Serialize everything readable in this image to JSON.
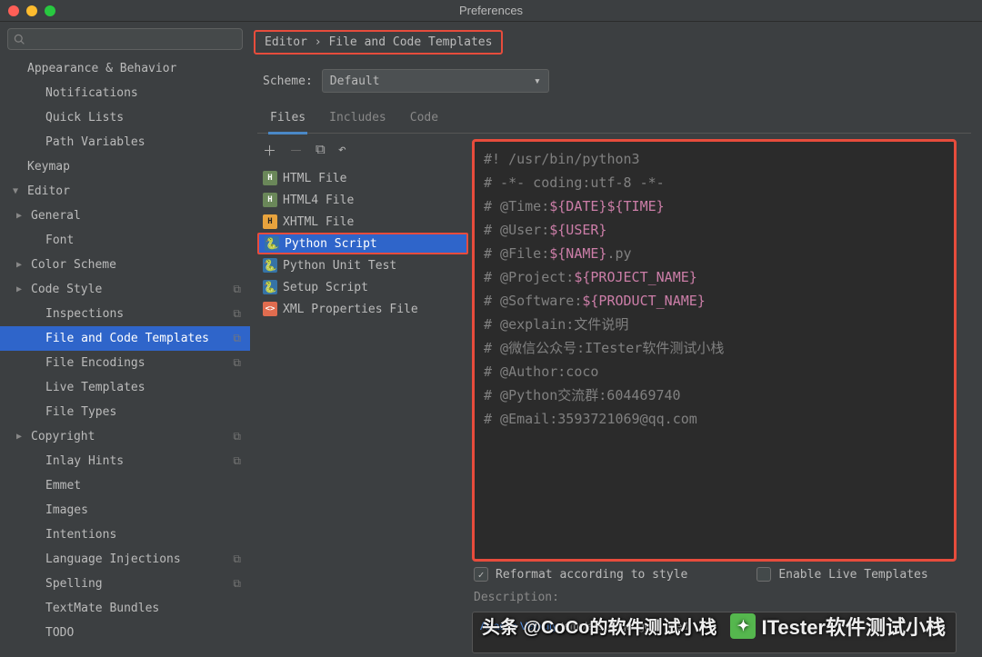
{
  "window": {
    "title": "Preferences"
  },
  "search": {
    "placeholder": ""
  },
  "breadcrumb": "Editor › File and Code Templates",
  "sidebar": {
    "items": [
      {
        "label": "Appearance & Behavior",
        "level": 0,
        "arrow": ""
      },
      {
        "label": "Notifications",
        "level": 2
      },
      {
        "label": "Quick Lists",
        "level": 2
      },
      {
        "label": "Path Variables",
        "level": 2
      },
      {
        "label": "Keymap",
        "level": 0
      },
      {
        "label": "Editor",
        "level": 0,
        "arrow": "▼"
      },
      {
        "label": "General",
        "level": 1,
        "arrow": "▶"
      },
      {
        "label": "Font",
        "level": 2
      },
      {
        "label": "Color Scheme",
        "level": 1,
        "arrow": "▶"
      },
      {
        "label": "Code Style",
        "level": 1,
        "arrow": "▶",
        "copy": true
      },
      {
        "label": "Inspections",
        "level": 2,
        "copy": true
      },
      {
        "label": "File and Code Templates",
        "level": 2,
        "copy": true,
        "sel": true
      },
      {
        "label": "File Encodings",
        "level": 2,
        "copy": true
      },
      {
        "label": "Live Templates",
        "level": 2
      },
      {
        "label": "File Types",
        "level": 2
      },
      {
        "label": "Copyright",
        "level": 1,
        "arrow": "▶",
        "copy": true
      },
      {
        "label": "Inlay Hints",
        "level": 2,
        "copy": true
      },
      {
        "label": "Emmet",
        "level": 2
      },
      {
        "label": "Images",
        "level": 2
      },
      {
        "label": "Intentions",
        "level": 2
      },
      {
        "label": "Language Injections",
        "level": 2,
        "copy": true
      },
      {
        "label": "Spelling",
        "level": 2,
        "copy": true
      },
      {
        "label": "TextMate Bundles",
        "level": 2
      },
      {
        "label": "TODO",
        "level": 2
      }
    ]
  },
  "scheme": {
    "label": "Scheme:",
    "value": "Default"
  },
  "tabs": [
    "Files",
    "Includes",
    "Code"
  ],
  "active_tab": 0,
  "template_files": [
    {
      "name": "HTML File",
      "icon": "html"
    },
    {
      "name": "HTML4 File",
      "icon": "html"
    },
    {
      "name": "XHTML File",
      "icon": "xhtml"
    },
    {
      "name": "Python Script",
      "icon": "py",
      "sel": true
    },
    {
      "name": "Python Unit Test",
      "icon": "py"
    },
    {
      "name": "Setup Script",
      "icon": "py"
    },
    {
      "name": "XML Properties File",
      "icon": "xml"
    }
  ],
  "code_lines": [
    {
      "pre": "#! /usr/bin/python3"
    },
    {
      "pre": "# -*- coding:utf-8 -*-"
    },
    {
      "pre": "# @Time:",
      "var": "${DATE}${TIME}"
    },
    {
      "pre": "# @User:",
      "var": "${USER}"
    },
    {
      "pre": "# @File:",
      "var": "${NAME}",
      "post": ".py"
    },
    {
      "pre": "# @Project:",
      "var": "${PROJECT_NAME}"
    },
    {
      "pre": "# @Software:",
      "var": "${PRODUCT_NAME}"
    },
    {
      "pre": "# @explain:文件说明"
    },
    {
      "pre": "# @微信公众号:ITester软件测试小栈"
    },
    {
      "pre": "# @Author:coco"
    },
    {
      "pre": "# @Python交流群:604469740"
    },
    {
      "pre": "# @Email:3593721069@qq.com"
    }
  ],
  "options": {
    "reformat": {
      "label": "Reformat according to style",
      "checked": true
    },
    "live": {
      "label": "Enable Live Templates",
      "checked": false
    }
  },
  "description": {
    "label": "Description:",
    "link": "Apache Velocity",
    "text": " template language is used"
  },
  "watermarks": {
    "wechat": "ITester软件测试小栈",
    "toutiao": "头条 @CoCo的软件测试小栈"
  }
}
